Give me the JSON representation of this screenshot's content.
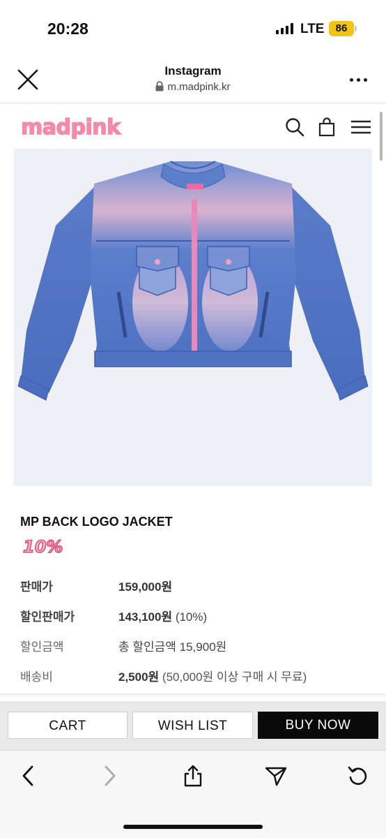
{
  "status_bar": {
    "time": "20:28",
    "network": "LTE",
    "battery": "86"
  },
  "browser": {
    "title": "Instagram",
    "url": "m.madpink.kr",
    "icons": [
      "close-icon",
      "lock-icon",
      "more-icon"
    ]
  },
  "site": {
    "logo_text": "MADPINK",
    "icons": [
      "search-icon",
      "cart-bag-icon",
      "menu-icon"
    ],
    "brand_color": "#f48aa6"
  },
  "product": {
    "name": "MP BACK LOGO JACKET",
    "discount_badge": "10%",
    "rows": [
      {
        "label": "판매가",
        "value": "159,000원",
        "extra": ""
      },
      {
        "label": "할인판매가",
        "value": "143,100원",
        "extra": " (10%)"
      },
      {
        "label": "할인금액",
        "value": "총 할인금액 15,900원",
        "extra": ""
      },
      {
        "label": "배송비",
        "value": "2,500원",
        "extra": " (50,000원 이상 구매 시 무료)"
      }
    ]
  },
  "actions": {
    "cart": "CART",
    "wish_list": "WISH LIST",
    "buy_now": "BUY NOW"
  },
  "nav": {
    "icons": [
      "back-icon",
      "forward-icon",
      "share-icon",
      "send-icon",
      "reload-icon"
    ]
  }
}
